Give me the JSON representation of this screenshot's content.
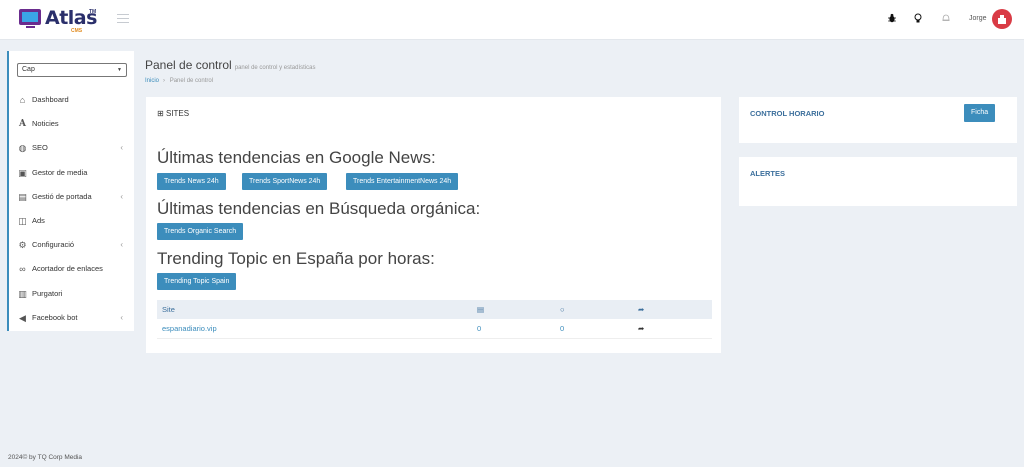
{
  "header": {
    "brand_word": "Atlas",
    "brand_tm": "TM",
    "brand_cms": "CMS",
    "user_name": "Jorge",
    "icons": [
      "bug-icon",
      "lightbulb-icon",
      "bell-icon"
    ],
    "avatar_color": "#d93b45"
  },
  "sidebar": {
    "select_value": "Cap",
    "items": [
      {
        "label": "Dashboard",
        "icon": "home-icon",
        "has_chevron": false
      },
      {
        "label": "Noticies",
        "icon": "font-icon",
        "has_chevron": false
      },
      {
        "label": "SEO",
        "icon": "globe-icon",
        "has_chevron": true
      },
      {
        "label": "Gestor de media",
        "icon": "image-icon",
        "has_chevron": false
      },
      {
        "label": "Gestió de portada",
        "icon": "columns-icon",
        "has_chevron": true
      },
      {
        "label": "Ads",
        "icon": "ad-icon",
        "has_chevron": false
      },
      {
        "label": "Configuració",
        "icon": "cogs-icon",
        "has_chevron": true
      },
      {
        "label": "Acortador de enlaces",
        "icon": "link-icon",
        "has_chevron": false
      },
      {
        "label": "Purgatori",
        "icon": "trash-icon",
        "has_chevron": false
      },
      {
        "label": "Facebook bot",
        "icon": "bullhorn-icon",
        "has_chevron": true
      }
    ]
  },
  "page": {
    "title": "Panel de control",
    "subtitle": "panel de control y estadísticas",
    "breadcrumb_home": "Inicio",
    "breadcrumb_current": "Panel de control"
  },
  "sites": {
    "header": "SITES",
    "google_title": "Últimas tendencias en Google News:",
    "google_buttons": [
      "Trends News 24h",
      "Trends SportNews 24h",
      "Trends EntertainmentNews 24h"
    ],
    "organic_title": "Últimas tendencias en Búsqueda orgánica:",
    "organic_button": "Trends Organic Search",
    "trending_title": "Trending Topic en España por horas:",
    "trending_button": "Trending Topic Spain",
    "table": {
      "col_site": "Site",
      "header_icons": [
        "newspaper-icon",
        "comment-icon",
        "share-icon"
      ],
      "rows": [
        {
          "site": "espanadiario.vip",
          "news": "0",
          "comments": "0"
        }
      ]
    }
  },
  "control_horario": {
    "title": "CONTROL HORARIO",
    "button": "Ficha"
  },
  "alertes": {
    "title": "ALERTES"
  },
  "footer": {
    "text": "2024© by TQ Corp Media"
  },
  "colors": {
    "accent": "#3c8dbc",
    "background": "#ecf0f5",
    "heading_blue": "#3c6f9c"
  }
}
